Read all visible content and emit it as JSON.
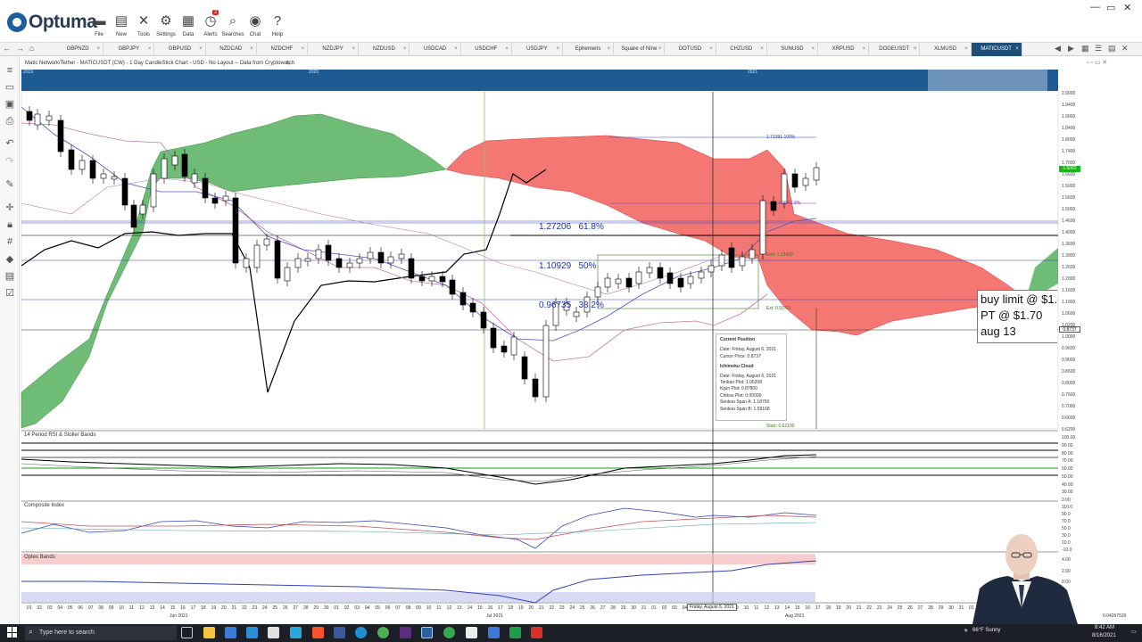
{
  "app": {
    "name": "Optuma",
    "toolbar": [
      {
        "label": "File",
        "icon": "folder-icon"
      },
      {
        "label": "New",
        "icon": "new-document-icon"
      },
      {
        "label": "Tools",
        "icon": "tools-icon"
      },
      {
        "label": "Settings",
        "icon": "gear-icon"
      },
      {
        "label": "Data",
        "icon": "data-icon"
      },
      {
        "label": "Alerts",
        "icon": "alarm-clock-icon",
        "badge": "2"
      },
      {
        "label": "Searches",
        "icon": "search-icon"
      },
      {
        "label": "Chat",
        "icon": "chat-icon"
      },
      {
        "label": "Help",
        "icon": "help-icon"
      }
    ],
    "window_controls": [
      "—",
      "▭",
      "✕"
    ]
  },
  "tabs": [
    "GBPNZD",
    "GBPJPY",
    "GBPUSD",
    "NZDCAD",
    "NZDCHF",
    "NZDJPY",
    "NZDUSD",
    "USDCAD",
    "USDCHF",
    "USDJPY",
    "Ephemeris",
    "Square of Nine",
    "DOTUSD",
    "CHZUSD",
    "SUNUSD",
    "XRPUSD",
    "DOGEUSDT",
    "XLMUSD",
    "MATICUSDT"
  ],
  "active_tab": "MATICUSDT",
  "chart": {
    "title": "Matic Network/Tether - MATICUSDT (CW) - 1 Day CandleStick Chart - USD - No Layout -- Data from Cryptowatch",
    "overview_years": [
      "2019",
      "2020",
      "2021"
    ],
    "price_axis": [
      "2.0000",
      "1.9400",
      "1.9000",
      "1.8400",
      "1.8000",
      "1.7400",
      "1.7000",
      "1.6600",
      "1.6000",
      "1.5600",
      "1.5000",
      "1.4600",
      "1.4000",
      "1.3600",
      "1.3000",
      "1.2600",
      "1.2000",
      "1.1600",
      "1.1000",
      "1.0600",
      "1.0200",
      "1.0000",
      "0.9600",
      "0.9000",
      "0.8600",
      "0.8000",
      "0.7600",
      "0.7000",
      "0.6600",
      "0.6200"
    ],
    "last_price": "1.5062",
    "cursor_price": "0.8737",
    "fib_levels": [
      {
        "value": "1.27206",
        "pct": "61.8%"
      },
      {
        "value": "1.10929",
        "pct": "50%"
      },
      {
        "value": "0.96735",
        "pct": "38.2%"
      }
    ],
    "fib_small": [
      {
        "text": "1.71391  100%"
      },
      {
        "text": "1.26  61.8%"
      },
      {
        "text": "End: 1.13499"
      },
      {
        "text": "Ext: 0.93771"
      },
      {
        "text": "Start: 0.62100"
      }
    ],
    "tooltip": {
      "title": "Current Position",
      "date": "Date: Friday, August 6, 2021",
      "cursor": "Cursor Price: 0.8737",
      "section": "Ichimoku Cloud",
      "date2": "Date: Friday, August 6, 2021",
      "tenkan": "Tenkan Plot: 1.06208",
      "kijun": "Kijun Plot: 0.87800",
      "chikou": "Chikou Plot: 0.00000",
      "spanA": "Senkou Span A: 1.18750",
      "spanB": "Senkou Span B: 1.59168"
    },
    "note": [
      "buy limit @ $1.",
      "PT @ $1.70",
      "aug 13"
    ],
    "panels": [
      {
        "title": "14 Period RSI & Stoller Bands",
        "axis": [
          "100.00",
          "90.00",
          "80.00",
          "70.00",
          "60.00",
          "50.00",
          "40.00",
          "30.00",
          "0.00"
        ]
      },
      {
        "title": "Composite Index",
        "axis": [
          "110.0",
          "90.0",
          "70.0",
          "50.0",
          "30.0",
          "10.0",
          "-10.0"
        ]
      },
      {
        "title": "Optex Bands",
        "axis": [
          "4.00",
          "2.00",
          "0.00"
        ]
      }
    ],
    "x_days": [
      "01",
      "02",
      "03",
      "04",
      "05",
      "06",
      "07",
      "08",
      "09",
      "10",
      "11",
      "12",
      "13",
      "14",
      "15",
      "16",
      "17",
      "18",
      "19",
      "20",
      "21",
      "22",
      "23",
      "24",
      "25",
      "26",
      "27",
      "28",
      "29",
      "30",
      "01",
      "02",
      "03",
      "04",
      "05",
      "06",
      "07",
      "08",
      "09",
      "10",
      "11",
      "12",
      "13",
      "14",
      "15",
      "16",
      "17",
      "18",
      "19",
      "20",
      "21",
      "22",
      "23",
      "24",
      "25",
      "26",
      "27",
      "28",
      "29",
      "30",
      "31",
      "01",
      "02",
      "03",
      "04",
      "05",
      "06",
      "07",
      "08",
      "09",
      "10",
      "11",
      "12",
      "13",
      "14",
      "15",
      "16",
      "17",
      "18",
      "19",
      "20",
      "21",
      "22",
      "23",
      "24",
      "25",
      "26",
      "27",
      "28",
      "29",
      "30",
      "31",
      "01",
      "02",
      "03",
      "04"
    ],
    "x_months": [
      "Jun 2021",
      "Jul 2021",
      "Aug 2021"
    ],
    "cursor_date": "Friday, August 6, 2021",
    "corner_value": "0.04267520"
  },
  "taskbar": {
    "search_placeholder": "Type here to search",
    "weather": "66°F  Sunny",
    "time": "8:42 AM",
    "date": "8/16/2021"
  }
}
